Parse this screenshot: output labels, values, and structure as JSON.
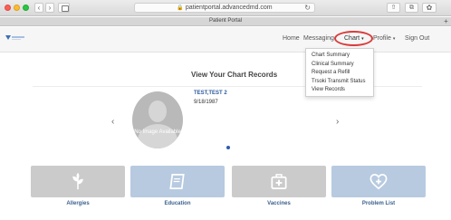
{
  "browser": {
    "url": "patientportal.advancedmd.com",
    "tab_title": "Patient Portal",
    "tab_add": "+",
    "nav_back": "‹",
    "nav_forward": "›",
    "reload_glyph": "↻",
    "lock_glyph": "🔒",
    "share_glyph": "⇧",
    "tabs_glyph": "⧉",
    "extension_glyph": "✿"
  },
  "nav": {
    "home": "Home",
    "messaging": "Messaging",
    "chart": "Chart",
    "profile": "Profile",
    "signout": "Sign Out",
    "caret": "▾"
  },
  "chart_menu": {
    "items": [
      "Chart Summary",
      "Clinical Summary",
      "Request a Refill",
      "Trsoki Transmit Status",
      "View Records"
    ]
  },
  "main": {
    "title": "View Your Chart Records",
    "patient_name": "TEST,TEST 2",
    "patient_dob": "9/18/1987",
    "avatar_text": "No Image Available",
    "prev": "‹",
    "next": "›"
  },
  "tiles": {
    "allergies": "Allergies",
    "education": "Education",
    "vaccines": "Vaccines",
    "problems": "Problem List"
  },
  "colors": {
    "highlight": "#d93b3b",
    "accent": "#2a5db0",
    "tile_gray": "#cbcbcb",
    "tile_blue": "#b7cae0"
  },
  "icons": {
    "allergies": "leaf-icon",
    "education": "book-icon",
    "vaccines": "medical-kit-icon",
    "problems": "heart-plus-icon"
  }
}
